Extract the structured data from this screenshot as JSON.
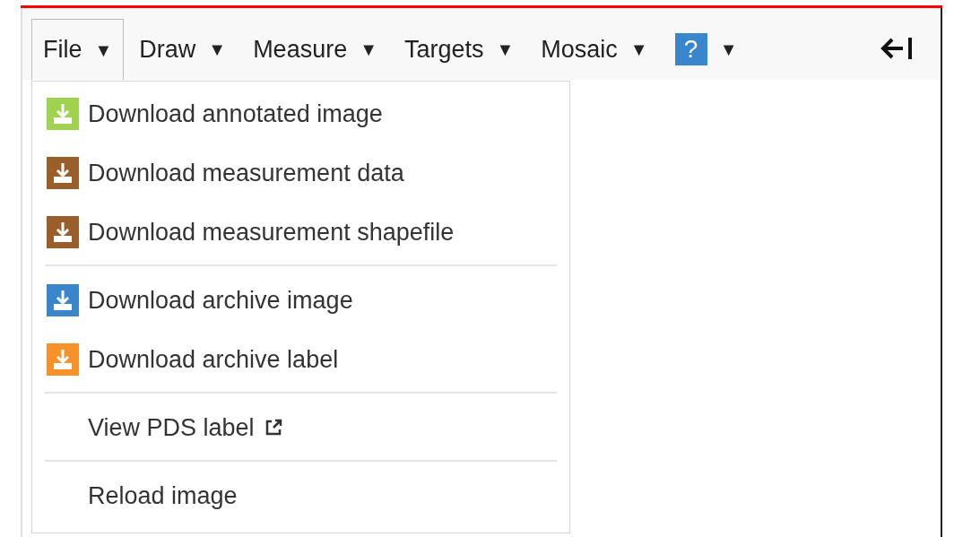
{
  "menubar": [
    {
      "label": "File",
      "kind": "text",
      "selected": true
    },
    {
      "label": "Draw",
      "kind": "text",
      "selected": false
    },
    {
      "label": "Measure",
      "kind": "text",
      "selected": false
    },
    {
      "label": "Targets",
      "kind": "text",
      "selected": false
    },
    {
      "label": "Mosaic",
      "kind": "text",
      "selected": false
    },
    {
      "label": "?",
      "kind": "help",
      "selected": false
    }
  ],
  "menubar_caret": "▼",
  "dropdown": {
    "sections": [
      {
        "items": [
          {
            "label": "Download annotated image",
            "kind": "download",
            "color": "#9fd34f"
          },
          {
            "label": "Download measurement data",
            "kind": "download",
            "color": "#9a5e2a"
          },
          {
            "label": "Download measurement shapefile",
            "kind": "download",
            "color": "#9a5e2a"
          }
        ]
      },
      {
        "items": [
          {
            "label": "Download archive image",
            "kind": "download",
            "color": "#3a86cc"
          },
          {
            "label": "Download archive label",
            "kind": "download",
            "color": "#f7922a"
          }
        ]
      },
      {
        "items": [
          {
            "label": "View PDS label",
            "kind": "external"
          }
        ]
      },
      {
        "items": [
          {
            "label": "Reload image",
            "kind": "plain"
          }
        ]
      }
    ]
  }
}
